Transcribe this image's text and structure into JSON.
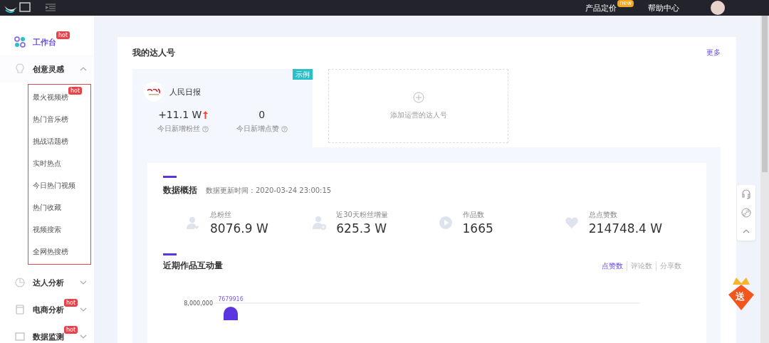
{
  "topbar": {
    "nav": [
      {
        "label": "产品定价",
        "badge": "new"
      },
      {
        "label": "帮助中心"
      }
    ]
  },
  "sidebar": {
    "items": [
      {
        "label": "工作台",
        "kind": "link",
        "selected": true,
        "badge": "hot"
      },
      {
        "label": "创意灵感",
        "kind": "group",
        "selected": false,
        "expanded": true,
        "children": [
          {
            "label": "最火视频榜",
            "badge": "hot"
          },
          {
            "label": "热门音乐榜"
          },
          {
            "label": "挑战话题榜"
          },
          {
            "label": "实时热点"
          },
          {
            "label": "今日热门视频"
          },
          {
            "label": "热门收藏"
          },
          {
            "label": "视频搜索"
          },
          {
            "label": "全网热搜榜"
          }
        ]
      },
      {
        "label": "达人分析",
        "kind": "group",
        "selected": false,
        "expanded": false
      },
      {
        "label": "电商分析",
        "kind": "group",
        "selected": false,
        "expanded": false,
        "badge": "hot"
      },
      {
        "label": "数据监测",
        "kind": "group",
        "selected": false,
        "expanded": false,
        "badge": "hot"
      }
    ]
  },
  "my_accounts": {
    "title": "我的达人号",
    "more": "更多",
    "account": {
      "tag": "示例",
      "name": "人民日报",
      "stats": [
        {
          "value": "+11.1 W",
          "rising": true,
          "label": "今日新增粉丝"
        },
        {
          "value": "0",
          "label": "今日新增点赞"
        }
      ]
    },
    "add_label": "添加运营的达人号"
  },
  "overview": {
    "title": "数据概括",
    "updated": "数据更新时间：2020-03-24 23:00:15",
    "metrics": [
      {
        "label": "总粉丝",
        "value": "8076.9 W"
      },
      {
        "label": "近30天粉丝增量",
        "value": "625.3 W"
      },
      {
        "label": "作品数",
        "value": "1665"
      },
      {
        "label": "总点赞数",
        "value": "214748.4 W"
      }
    ]
  },
  "interaction": {
    "title": "近期作品互动量",
    "tabs": [
      {
        "label": "点赞数",
        "selected": true
      },
      {
        "label": "评论数",
        "selected": false
      },
      {
        "label": "分享数",
        "selected": false
      }
    ],
    "chart": {
      "tick_label": "8,000,000",
      "bar_label": "7679916"
    }
  },
  "gift_badge": "送"
}
